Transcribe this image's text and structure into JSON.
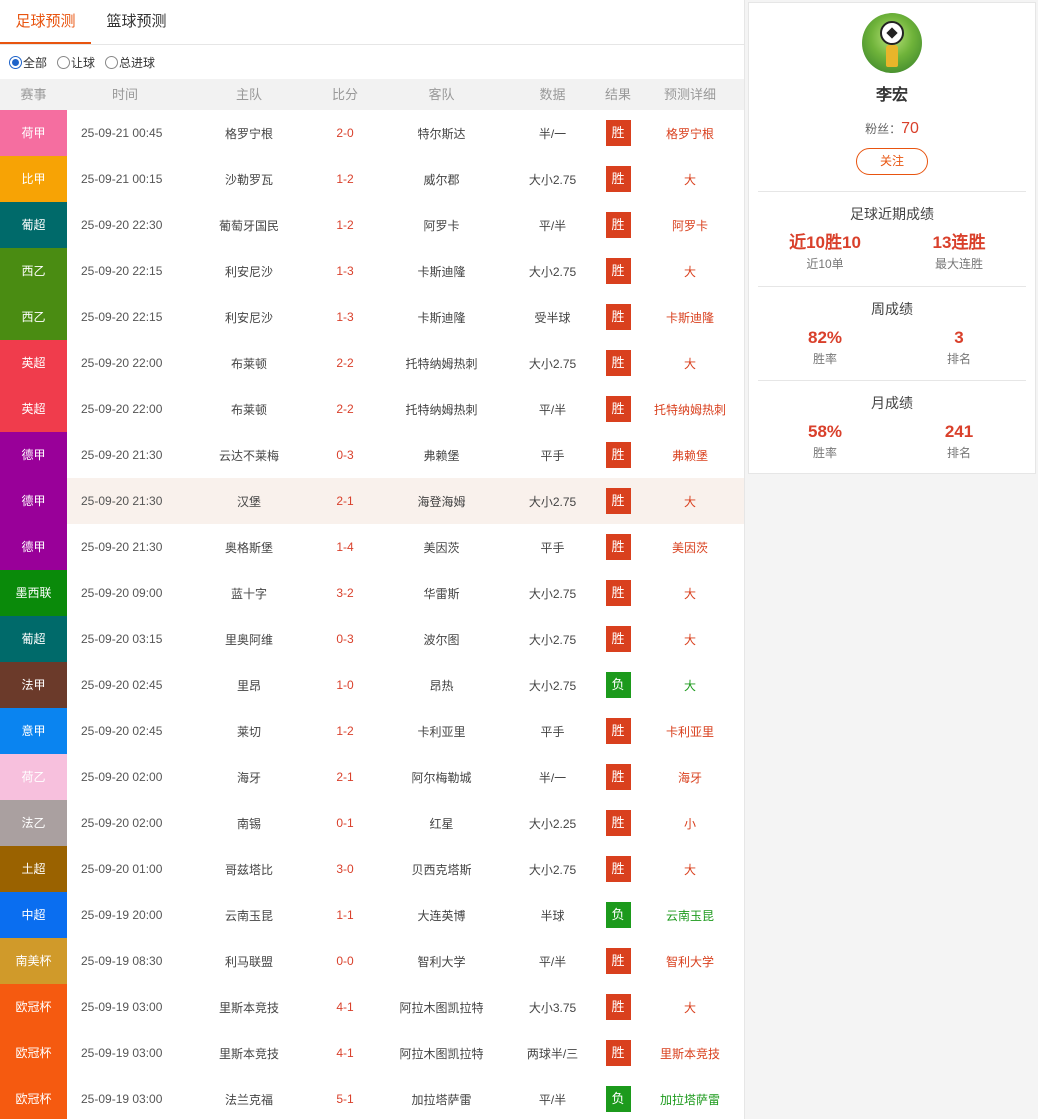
{
  "tabs": [
    {
      "label": "足球预测",
      "active": true
    },
    {
      "label": "篮球预测",
      "active": false
    }
  ],
  "filters": [
    {
      "label": "全部",
      "checked": true
    },
    {
      "label": "让球",
      "checked": false
    },
    {
      "label": "总进球",
      "checked": false
    }
  ],
  "table": {
    "headers": [
      "赛事",
      "时间",
      "主队",
      "比分",
      "客队",
      "数据",
      "结果",
      "预测详细"
    ],
    "rows": [
      {
        "league": "荷甲",
        "color": "#f56ea0",
        "time": "25-09-21 00:45",
        "home": "格罗宁根",
        "score": "2-0",
        "away": "特尔斯达",
        "data": "半/一",
        "result": "胜",
        "win": true,
        "detail": "格罗宁根"
      },
      {
        "league": "比甲",
        "color": "#f7a305",
        "time": "25-09-21 00:15",
        "home": "沙勒罗瓦",
        "score": "1-2",
        "away": "威尔郡",
        "data": "大小2.75",
        "result": "胜",
        "win": true,
        "detail": "大"
      },
      {
        "league": "葡超",
        "color": "#006a6a",
        "time": "25-09-20 22:30",
        "home": "葡萄牙国民",
        "score": "1-2",
        "away": "阿罗卡",
        "data": "平/半",
        "result": "胜",
        "win": true,
        "detail": "阿罗卡"
      },
      {
        "league": "西乙",
        "color": "#4a8c12",
        "time": "25-09-20 22:15",
        "home": "利安尼沙",
        "score": "1-3",
        "away": "卡斯迪隆",
        "data": "大小2.75",
        "result": "胜",
        "win": true,
        "detail": "大"
      },
      {
        "league": "西乙",
        "color": "#4a8c12",
        "time": "25-09-20 22:15",
        "home": "利安尼沙",
        "score": "1-3",
        "away": "卡斯迪隆",
        "data": "受半球",
        "result": "胜",
        "win": true,
        "detail": "卡斯迪隆"
      },
      {
        "league": "英超",
        "color": "#f03c4c",
        "time": "25-09-20 22:00",
        "home": "布莱顿",
        "score": "2-2",
        "away": "托特纳姆热刺",
        "data": "大小2.75",
        "result": "胜",
        "win": true,
        "detail": "大"
      },
      {
        "league": "英超",
        "color": "#f03c4c",
        "time": "25-09-20 22:00",
        "home": "布莱顿",
        "score": "2-2",
        "away": "托特纳姆热刺",
        "data": "平/半",
        "result": "胜",
        "win": true,
        "detail": "托特纳姆热刺"
      },
      {
        "league": "德甲",
        "color": "#990099",
        "time": "25-09-20 21:30",
        "home": "云达不莱梅",
        "score": "0-3",
        "away": "弗赖堡",
        "data": "平手",
        "result": "胜",
        "win": true,
        "detail": "弗赖堡"
      },
      {
        "league": "德甲",
        "color": "#990099",
        "time": "25-09-20 21:30",
        "home": "汉堡",
        "score": "2-1",
        "away": "海登海姆",
        "data": "大小2.75",
        "result": "胜",
        "win": true,
        "detail": "大",
        "highlight": true
      },
      {
        "league": "德甲",
        "color": "#990099",
        "time": "25-09-20 21:30",
        "home": "奥格斯堡",
        "score": "1-4",
        "away": "美因茨",
        "data": "平手",
        "result": "胜",
        "win": true,
        "detail": "美因茨"
      },
      {
        "league": "墨西联",
        "color": "#0a8a0a",
        "time": "25-09-20 09:00",
        "home": "蓝十字",
        "score": "3-2",
        "away": "华雷斯",
        "data": "大小2.75",
        "result": "胜",
        "win": true,
        "detail": "大"
      },
      {
        "league": "葡超",
        "color": "#006a6a",
        "time": "25-09-20 03:15",
        "home": "里奥阿维",
        "score": "0-3",
        "away": "波尔图",
        "data": "大小2.75",
        "result": "胜",
        "win": true,
        "detail": "大"
      },
      {
        "league": "法甲",
        "color": "#6b3a2a",
        "time": "25-09-20 02:45",
        "home": "里昂",
        "score": "1-0",
        "away": "昂热",
        "data": "大小2.75",
        "result": "负",
        "win": false,
        "detail": "大"
      },
      {
        "league": "意甲",
        "color": "#0a84f0",
        "time": "25-09-20 02:45",
        "home": "莱切",
        "score": "1-2",
        "away": "卡利亚里",
        "data": "平手",
        "result": "胜",
        "win": true,
        "detail": "卡利亚里"
      },
      {
        "league": "荷乙",
        "color": "#f7c0dd",
        "time": "25-09-20 02:00",
        "home": "海牙",
        "score": "2-1",
        "away": "阿尔梅勒城",
        "data": "半/一",
        "result": "胜",
        "win": true,
        "detail": "海牙"
      },
      {
        "league": "法乙",
        "color": "#aaa0a0",
        "time": "25-09-20 02:00",
        "home": "南锡",
        "score": "0-1",
        "away": "红星",
        "data": "大小2.25",
        "result": "胜",
        "win": true,
        "detail": "小"
      },
      {
        "league": "土超",
        "color": "#9a6200",
        "time": "25-09-20 01:00",
        "home": "哥兹塔比",
        "score": "3-0",
        "away": "贝西克塔斯",
        "data": "大小2.75",
        "result": "胜",
        "win": true,
        "detail": "大"
      },
      {
        "league": "中超",
        "color": "#0a6ef0",
        "time": "25-09-19 20:00",
        "home": "云南玉昆",
        "score": "1-1",
        "away": "大连英博",
        "data": "半球",
        "result": "负",
        "win": false,
        "detail": "云南玉昆"
      },
      {
        "league": "南美杯",
        "color": "#d09a2a",
        "time": "25-09-19 08:30",
        "home": "利马联盟",
        "score": "0-0",
        "away": "智利大学",
        "data": "平/半",
        "result": "胜",
        "win": true,
        "detail": "智利大学"
      },
      {
        "league": "欧冠杯",
        "color": "#f55a10",
        "time": "25-09-19 03:00",
        "home": "里斯本竞技",
        "score": "4-1",
        "away": "阿拉木图凯拉特",
        "data": "大小3.75",
        "result": "胜",
        "win": true,
        "detail": "大"
      },
      {
        "league": "欧冠杯",
        "color": "#f55a10",
        "time": "25-09-19 03:00",
        "home": "里斯本竞技",
        "score": "4-1",
        "away": "阿拉木图凯拉特",
        "data": "两球半/三",
        "result": "胜",
        "win": true,
        "detail": "里斯本竞技"
      },
      {
        "league": "欧冠杯",
        "color": "#f55a10",
        "time": "25-09-19 03:00",
        "home": "法兰克福",
        "score": "5-1",
        "away": "加拉塔萨雷",
        "data": "平/半",
        "result": "负",
        "win": false,
        "detail": "加拉塔萨雷"
      }
    ]
  },
  "profile": {
    "name": "李宏",
    "fans_label": "粉丝：",
    "fans_count": "70",
    "follow_label": "关注",
    "recent": {
      "title": "足球近期成绩",
      "stats": [
        {
          "value": "近10胜10",
          "label": "近10单"
        },
        {
          "value": "13连胜",
          "label": "最大连胜"
        }
      ]
    },
    "weekly": {
      "title": "周成绩",
      "stats": [
        {
          "value": "82%",
          "label": "胜率"
        },
        {
          "value": "3",
          "label": "排名"
        }
      ]
    },
    "monthly": {
      "title": "月成绩",
      "stats": [
        {
          "value": "58%",
          "label": "胜率"
        },
        {
          "value": "241",
          "label": "排名"
        }
      ]
    }
  }
}
